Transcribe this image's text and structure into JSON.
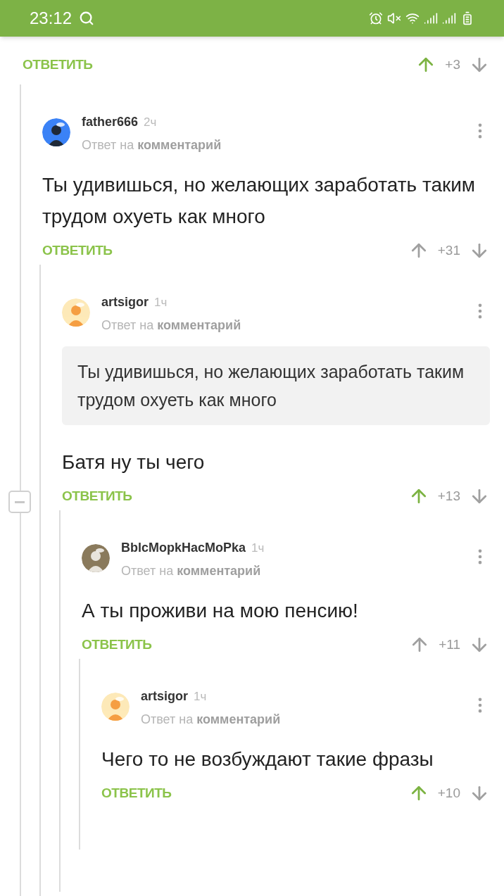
{
  "status_bar": {
    "time": "23:12"
  },
  "top_actions": {
    "reply": "ОТВЕТИТЬ",
    "score": "+3",
    "upvoted": true
  },
  "collapse_control": {
    "expanded": true
  },
  "comments": [
    {
      "author": "father666",
      "time": "2ч",
      "reply_prefix": "Ответ на",
      "reply_link": "комментарий",
      "text": "Ты удивишься, но желающих заработать таким трудом охуеть как много",
      "reply": "ОТВЕТИТЬ",
      "score": "+31",
      "upvoted": false,
      "children": [
        {
          "author": "artsigor",
          "time": "1ч",
          "reply_prefix": "Ответ на",
          "reply_link": "комментарий",
          "quote": "Ты удивишься, но желающих заработать таким трудом охуеть как много",
          "text": "Батя ну ты чего",
          "reply": "ОТВЕТИТЬ",
          "score": "+13",
          "upvoted": true,
          "children": [
            {
              "author": "BblcMopkHacMoPka",
              "time": "1ч",
              "reply_prefix": "Ответ на",
              "reply_link": "комментарий",
              "text": "А ты проживи на мою пенсию!",
              "reply": "ОТВЕТИТЬ",
              "score": "+11",
              "upvoted": false,
              "children": [
                {
                  "author": "artsigor",
                  "time": "1ч",
                  "reply_prefix": "Ответ на",
                  "reply_link": "комментарий",
                  "text": "Чего то не возбуждают такие фразы",
                  "reply": "ОТВЕТИТЬ",
                  "score": "+10",
                  "upvoted": true
                }
              ]
            }
          ]
        }
      ]
    }
  ]
}
